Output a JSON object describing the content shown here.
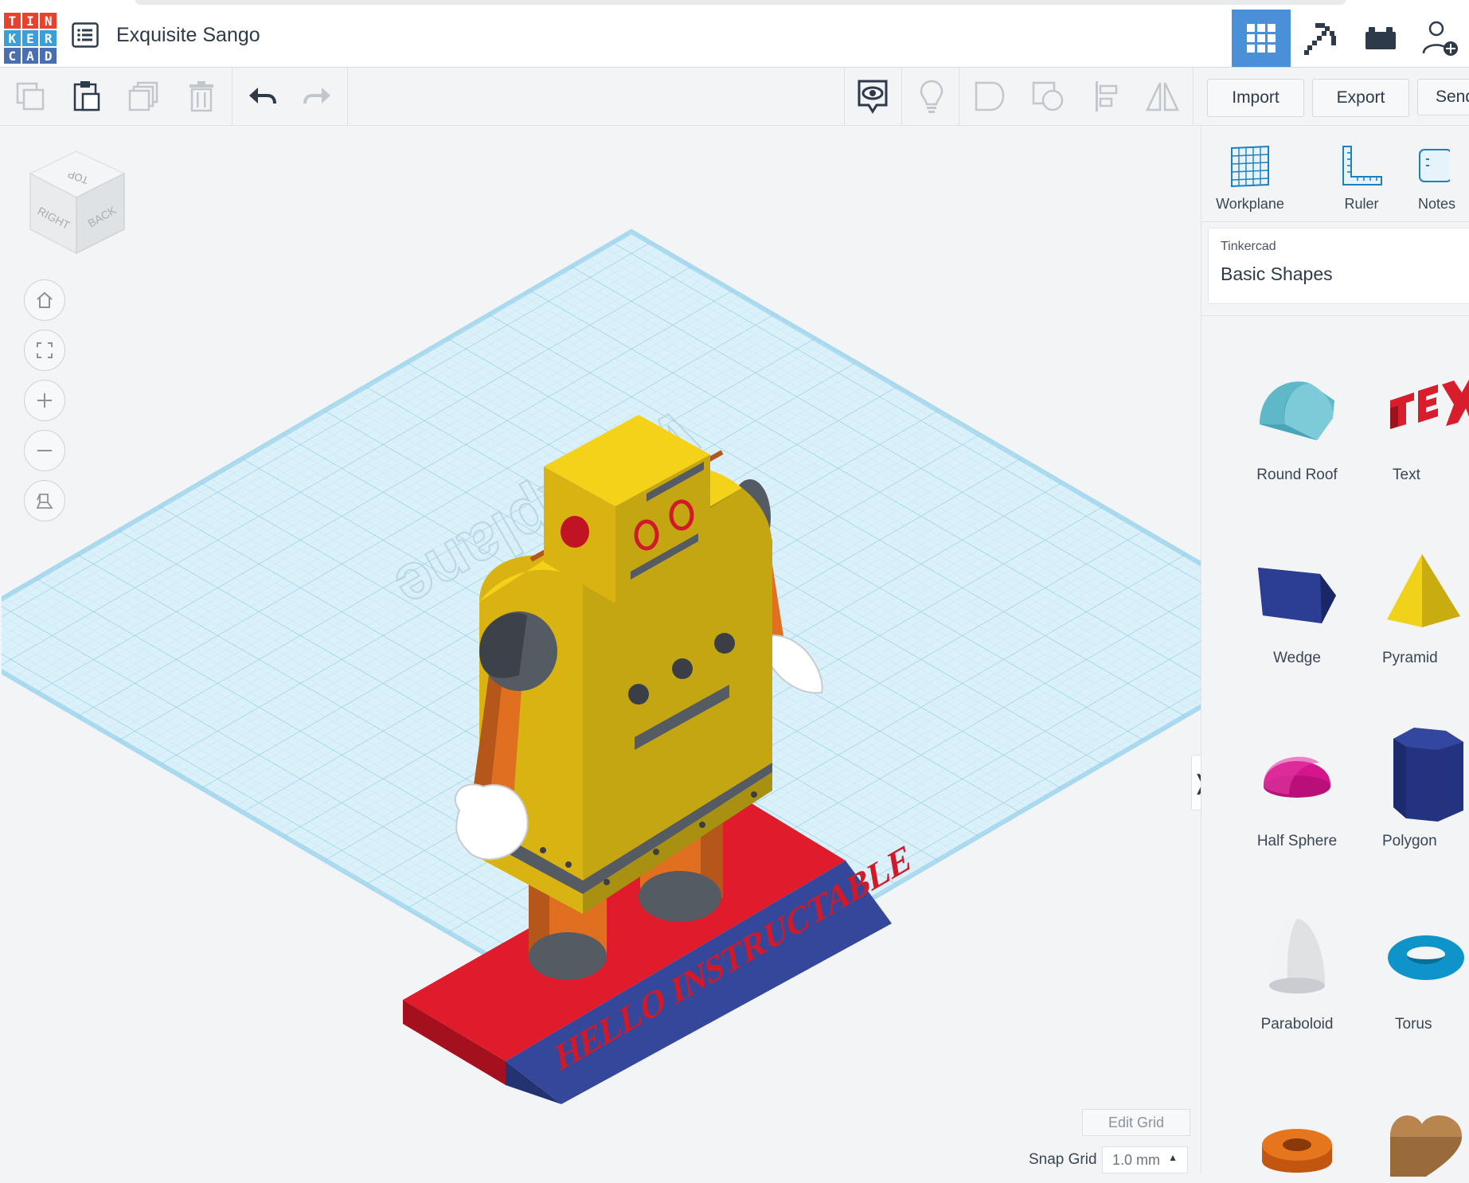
{
  "header": {
    "logo_letters": [
      "T",
      "I",
      "N",
      "K",
      "E",
      "R",
      "C",
      "A",
      "D"
    ],
    "logo_colors": [
      "#e8412c",
      "#e8412c",
      "#e8412c",
      "#3a9fd8",
      "#3a9fd8",
      "#3a9fd8",
      "#4a6fb0",
      "#4a6fb0",
      "#4a6fb0"
    ],
    "title": "Exquisite Sango",
    "active_color": "#4a90d9"
  },
  "toolbar": {
    "import_label": "Import",
    "export_label": "Export",
    "send_label": "Send"
  },
  "viewcube": {
    "top": "TOP",
    "right": "RIGHT",
    "back": "BACK"
  },
  "viewport": {
    "workplane_label": "Workplane",
    "model_text": "HELLO INSTRUCTABLE",
    "edit_grid_label": "Edit Grid",
    "snap_grid_label": "Snap Grid",
    "snap_grid_value": "1.0 mm"
  },
  "panel": {
    "tools": [
      {
        "label": "Workplane",
        "icon": "workplane-icon"
      },
      {
        "label": "Ruler",
        "icon": "ruler-icon"
      },
      {
        "label": "Notes",
        "icon": "notes-icon"
      }
    ],
    "library_source": "Tinkercad",
    "library_title": "Basic Shapes",
    "shapes": [
      {
        "label": "Round Roof"
      },
      {
        "label": "Text"
      },
      {
        "label": "Wedge"
      },
      {
        "label": "Pyramid"
      },
      {
        "label": "Half Sphere"
      },
      {
        "label": "Polygon"
      },
      {
        "label": "Paraboloid"
      },
      {
        "label": "Torus"
      }
    ]
  },
  "colors": {
    "grid_line": "#bfe3f2",
    "grid_bg": "#dbf1fa",
    "robot_yellow": "#f5d21a",
    "robot_orange": "#e07020",
    "base_red": "#e01c2c",
    "base_blue": "#34479a"
  }
}
